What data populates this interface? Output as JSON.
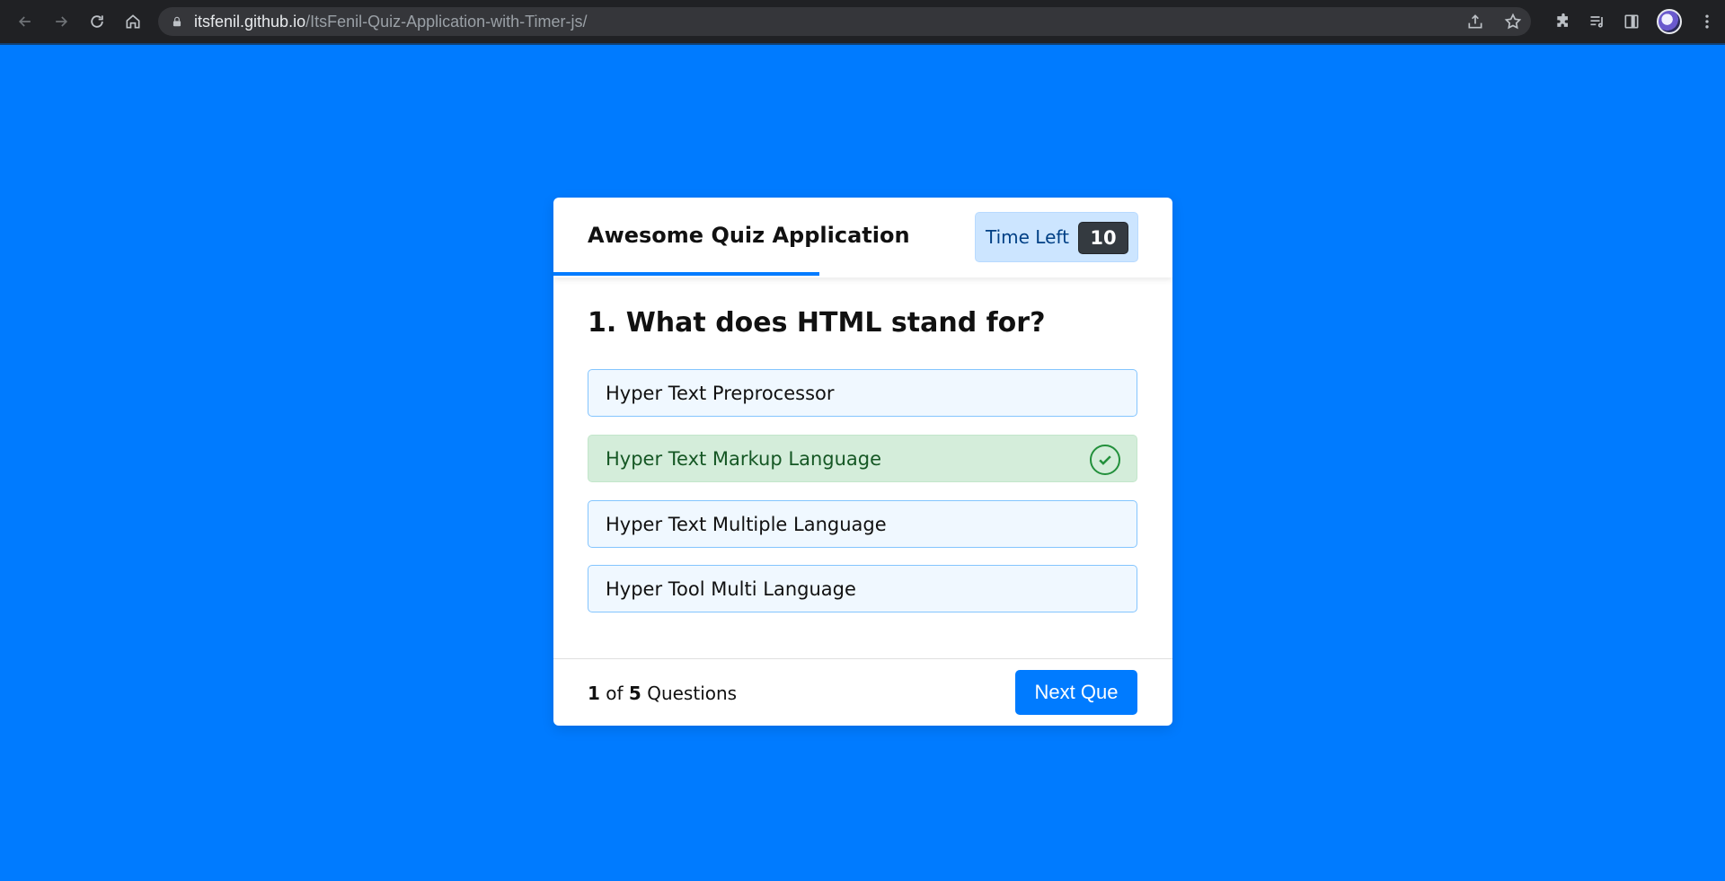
{
  "browser": {
    "url_host": "itsfenil.github.io",
    "url_path": "/ItsFenil-Quiz-Application-with-Timer-js/",
    "icons": [
      "back-icon",
      "forward-icon",
      "reload-icon",
      "home-icon",
      "lock-icon",
      "share-icon",
      "bookmark-star-icon",
      "extensions-icon",
      "media-controls-icon",
      "side-panel-icon",
      "profile-avatar",
      "menu-kebab-icon"
    ]
  },
  "quiz": {
    "title": "Awesome Quiz Application",
    "timer": {
      "label": "Time Left",
      "value": "10"
    },
    "time_progress": 0.43,
    "question": "1. What does HTML stand for?",
    "options": [
      {
        "text": "Hyper Text Preprocessor",
        "state": "default"
      },
      {
        "text": "Hyper Text Markup Language",
        "state": "correct"
      },
      {
        "text": "Hyper Text Multiple Language",
        "state": "default"
      },
      {
        "text": "Hyper Tool Multi Language",
        "state": "default"
      }
    ],
    "footer": {
      "current": "1",
      "of": "of",
      "total": "5",
      "suffix": "Questions",
      "next_label": "Next Que"
    }
  },
  "colors": {
    "background": "#007bff",
    "accent": "#007bff",
    "correct_bg": "#d4edda",
    "correct_fg": "#155724",
    "timer_bg": "#cce5ff"
  }
}
